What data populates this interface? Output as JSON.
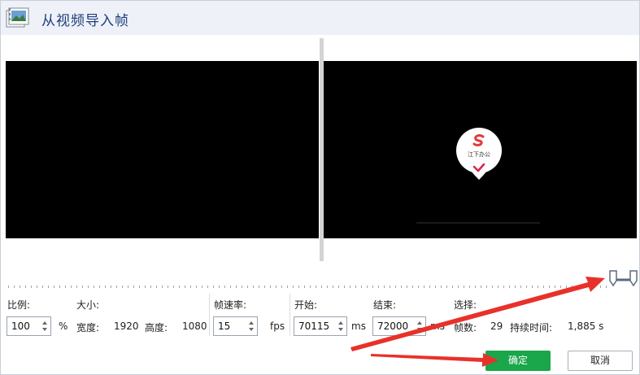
{
  "dialog": {
    "title": "从视频导入帧"
  },
  "preview": {
    "logo_text": "江下办公"
  },
  "controls": {
    "scale_label": "比例:",
    "scale_value": "100",
    "scale_unit": "%",
    "size_label": "大小:",
    "width_label": "宽度:",
    "width_value": "1920",
    "height_label": "高度:",
    "height_value": "1080",
    "fps_label": "帧速率:",
    "fps_value": "15",
    "fps_unit": "fps",
    "start_label": "开始:",
    "start_value": "70115",
    "start_unit": "ms",
    "end_label": "结束:",
    "end_value": "72000",
    "end_unit": "ms",
    "selection_label": "选择:",
    "frames_label": "帧数:",
    "frames_value": "29",
    "duration_label": "持续时间:",
    "duration_value": "1,885 s"
  },
  "buttons": {
    "ok_label": "确定",
    "cancel_label": "取消"
  },
  "colors": {
    "ok_button": "#1aa64a",
    "annotation_arrow": "#e8312a",
    "title_text": "#1f3d7a"
  }
}
